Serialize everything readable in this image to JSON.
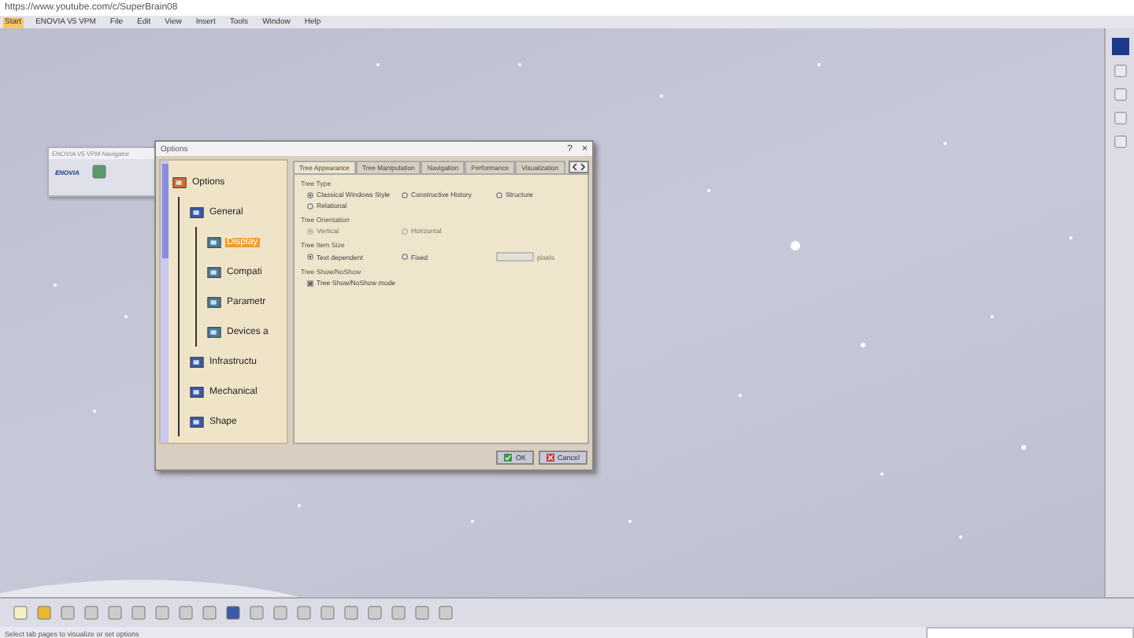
{
  "address_bar": {
    "url": "https://www.youtube.com/c/SuperBrain08"
  },
  "menu_bar": [
    {
      "label": "Start",
      "selected": true
    },
    {
      "label": "ENOVIA V5 VPM",
      "selected": false
    },
    {
      "label": "File",
      "selected": false
    },
    {
      "label": "Edit",
      "selected": false
    },
    {
      "label": "View",
      "selected": false
    },
    {
      "label": "Insert",
      "selected": false
    },
    {
      "label": "Tools",
      "selected": false
    },
    {
      "label": "Window",
      "selected": false
    },
    {
      "label": "Help",
      "selected": false
    }
  ],
  "navigator_window": {
    "title": "ENOVIA V5 VPM Navigator",
    "logo_text": "ENOVIA"
  },
  "options_dialog": {
    "title": "Options",
    "help": "?",
    "close": "×",
    "tree": [
      {
        "label": "Options",
        "selected": false,
        "children": [
          {
            "label": "General",
            "selected": false,
            "children": [
              {
                "label": "Display",
                "selected": true
              },
              {
                "label": "Compati",
                "selected": false
              },
              {
                "label": "Parametr",
                "selected": false
              },
              {
                "label": "Devices a",
                "selected": false
              }
            ]
          },
          {
            "label": "Infrastructu",
            "selected": false
          },
          {
            "label": "Mechanical",
            "selected": false
          },
          {
            "label": "Shape",
            "selected": false
          }
        ]
      }
    ],
    "tabs": [
      {
        "label": "Tree Appearance",
        "selected": true
      },
      {
        "label": "Tree Manipulation",
        "selected": false
      },
      {
        "label": "Navigation",
        "selected": false
      },
      {
        "label": "Performance",
        "selected": false
      },
      {
        "label": "Visualization",
        "selected": false
      }
    ],
    "sections": [
      {
        "title": "Tree Type",
        "items": [
          {
            "kind": "radio",
            "label": "Classical Windows Style",
            "checked": true,
            "disabled": false
          },
          {
            "kind": "radio",
            "label": "Constructive History",
            "checked": false,
            "disabled": false
          },
          {
            "kind": "radio",
            "label": "Structure",
            "checked": false,
            "disabled": false
          },
          {
            "kind": "radio",
            "label": "Relational",
            "checked": false,
            "disabled": false
          }
        ]
      },
      {
        "title": "Tree Orientation",
        "items": [
          {
            "kind": "radio",
            "label": "Vertical",
            "checked": true,
            "disabled": true
          },
          {
            "kind": "radio",
            "label": "Horizontal",
            "checked": false,
            "disabled": true
          }
        ]
      },
      {
        "title": "Tree Item Size",
        "items": [
          {
            "kind": "radio",
            "label": "Text dependent",
            "checked": true,
            "disabled": false
          },
          {
            "kind": "radio",
            "label": "Fixed",
            "checked": false,
            "disabled": false
          },
          {
            "kind": "field",
            "label": "pixels",
            "disabled": true
          }
        ]
      },
      {
        "title": "Tree Show/NoShow",
        "items": [
          {
            "kind": "checkbox",
            "label": "Tree Show/NoShow mode",
            "checked": true,
            "disabled": false
          }
        ]
      }
    ],
    "buttons": [
      {
        "kind": "ok",
        "label": "OK"
      },
      {
        "kind": "cancel",
        "label": "Cancel"
      }
    ]
  },
  "status_bar": {
    "text": "Select tab pages to visualize or set options"
  }
}
